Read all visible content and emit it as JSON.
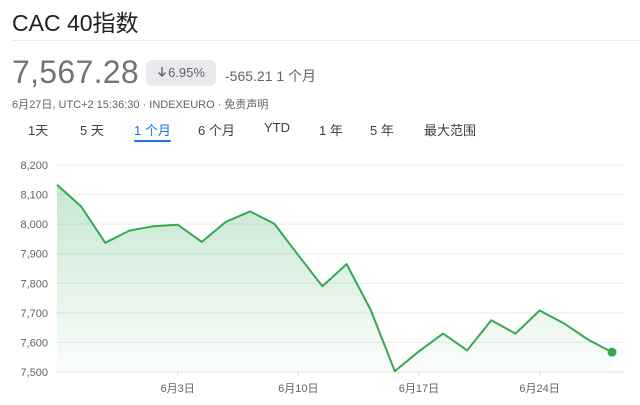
{
  "header": {
    "title": "CAC 40指数",
    "price": "7,567.28",
    "change_percent": "6.95%",
    "change_value": "-565.21 1 个月",
    "meta": "6月27日, UTC+2 15:36:30 · INDEXEURO · 免责声明"
  },
  "tabs": [
    {
      "label": "1天"
    },
    {
      "label": "5 天"
    },
    {
      "label": "1 个月"
    },
    {
      "label": "6 个月"
    },
    {
      "label": "YTD"
    },
    {
      "label": "1 年"
    },
    {
      "label": "5 年"
    },
    {
      "label": "最大范围"
    }
  ],
  "active_tab": "1 个月",
  "colors": {
    "line": "#34a853",
    "accent": "#1a73e8"
  },
  "chart_data": {
    "type": "area",
    "title": "",
    "xlabel": "",
    "ylabel": "",
    "ylim": [
      7500,
      8200
    ],
    "y_ticks": [
      "8,200",
      "8,100",
      "8,000",
      "7,900",
      "7,800",
      "7,700",
      "7,600",
      "7,500"
    ],
    "x_tick_labels": [
      "6月3日",
      "6月10日",
      "6月17日",
      "6月24日"
    ],
    "x": [
      "5月27日",
      "5月28日",
      "5月29日",
      "5月30日",
      "5月31日",
      "6月3日",
      "6月4日",
      "6月5日",
      "6月6日",
      "6月7日",
      "6月10日",
      "6月11日",
      "6月12日",
      "6月13日",
      "6月14日",
      "6月17日",
      "6月18日",
      "6月19日",
      "6月20日",
      "6月21日",
      "6月24日",
      "6月25日",
      "6月26日",
      "6月27日"
    ],
    "values": [
      8133,
      8060,
      7937,
      7978,
      7993,
      7998,
      7940,
      8008,
      8043,
      8002,
      7895,
      7790,
      7865,
      7710,
      7503,
      7570,
      7630,
      7573,
      7675,
      7630,
      7708,
      7665,
      7610,
      7567
    ]
  }
}
